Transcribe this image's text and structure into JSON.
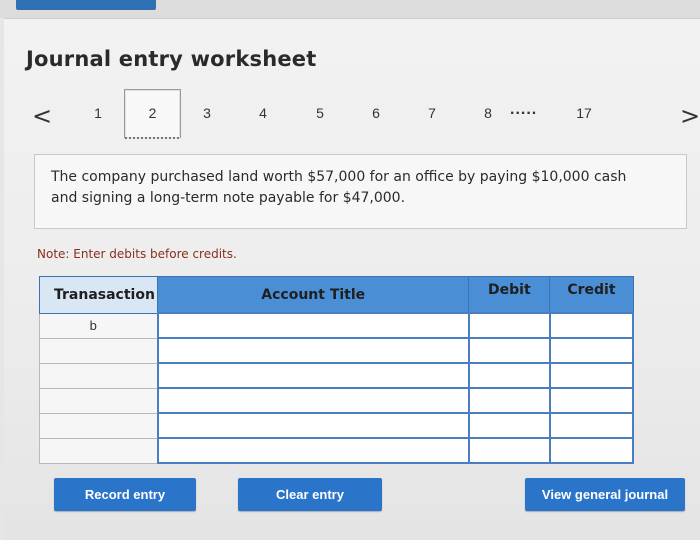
{
  "title": "Journal entry worksheet",
  "pager": {
    "prev_icon": "chevron-left-icon",
    "next_icon": "chevron-right-icon",
    "prev_glyph": "<",
    "next_glyph": ">",
    "pages": [
      "1",
      "2",
      "3",
      "4",
      "5",
      "6",
      "7",
      "8"
    ],
    "current": "2",
    "ellipsis": ".....",
    "last": "17"
  },
  "prompt": "The company purchased land worth $57,000 for an office by paying $10,000 cash and signing a long-term note payable for $47,000.",
  "note": "Note: Enter debits before credits.",
  "table": {
    "headers": {
      "transaction": "Tranasaction",
      "account_title": "Account Title",
      "debit": "Debit",
      "credit": "Credit"
    },
    "rows": [
      {
        "transaction": "b",
        "account_title": "",
        "debit": "",
        "credit": ""
      },
      {
        "transaction": "",
        "account_title": "",
        "debit": "",
        "credit": ""
      },
      {
        "transaction": "",
        "account_title": "",
        "debit": "",
        "credit": ""
      },
      {
        "transaction": "",
        "account_title": "",
        "debit": "",
        "credit": ""
      },
      {
        "transaction": "",
        "account_title": "",
        "debit": "",
        "credit": ""
      },
      {
        "transaction": "",
        "account_title": "",
        "debit": "",
        "credit": ""
      }
    ]
  },
  "buttons": {
    "record": "Record entry",
    "clear": "Clear entry",
    "view_journal": "View general journal"
  },
  "colors": {
    "accent": "#2a74c9",
    "header_blue": "#4a8fd6",
    "note_text": "#8a2e1e"
  }
}
